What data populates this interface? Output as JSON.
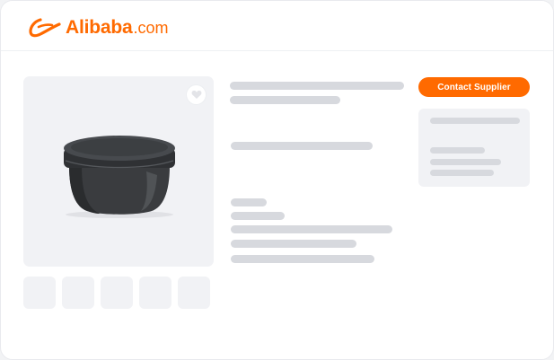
{
  "header": {
    "brand": "Alibaba",
    "brand_suffix": ".com",
    "logo_icon": "alibaba-logo-mark",
    "brand_color": "#ff6a00"
  },
  "product": {
    "favorite_icon": "heart-icon",
    "image": "black-round-jar-with-lid",
    "thumbnail_count": 5
  },
  "supplier": {
    "contact_label": "Contact Supplier"
  },
  "colors": {
    "accent": "#ff6a00",
    "placeholder": "#d7d9de",
    "panel": "#f1f2f5"
  }
}
